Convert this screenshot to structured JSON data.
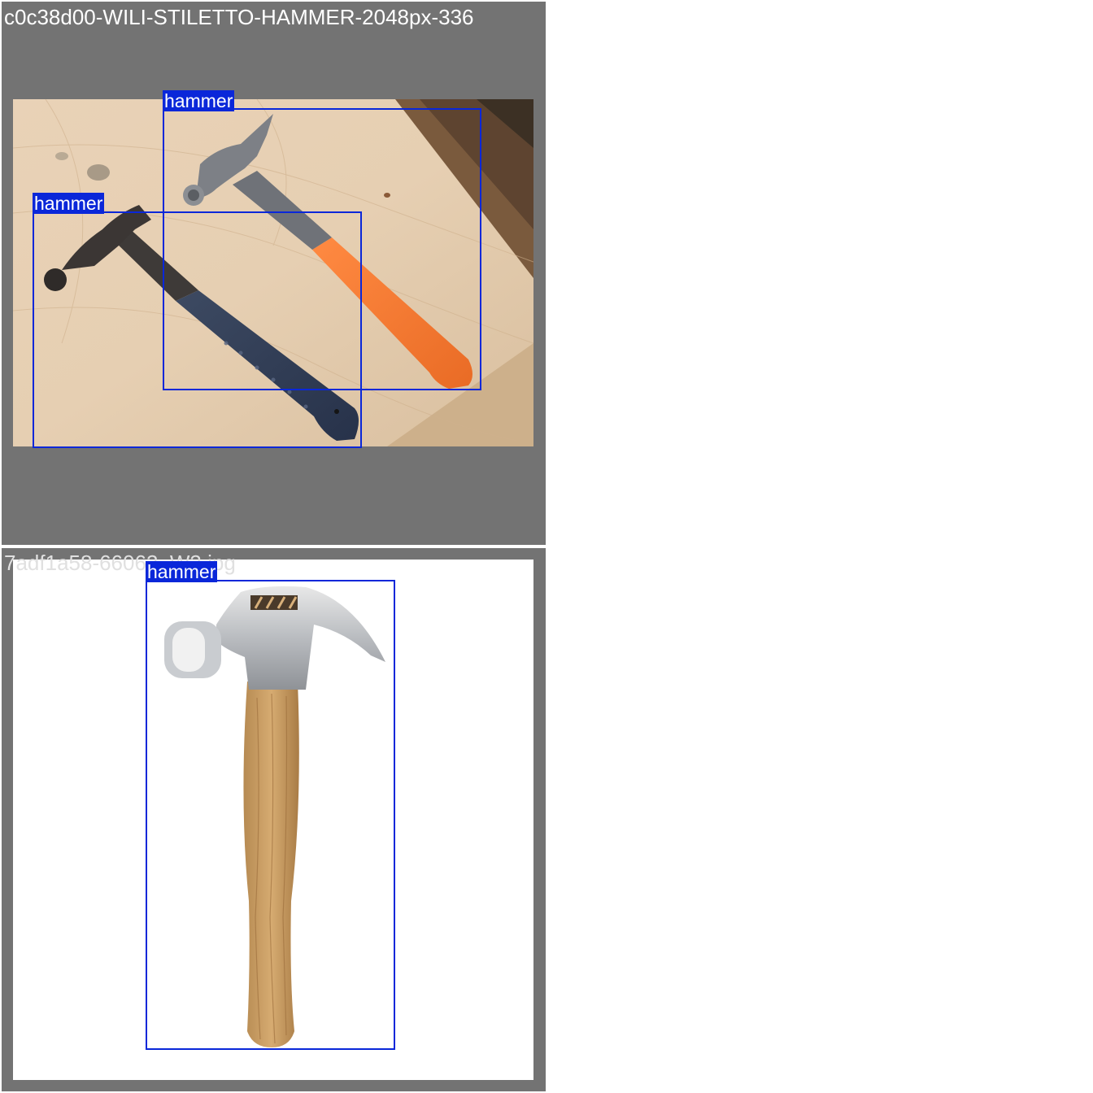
{
  "tiles": [
    {
      "title": "c0c38d00-WILI-STILETTO-HAMMER-2048px-336",
      "detections": [
        {
          "label": "hammer"
        },
        {
          "label": "hammer"
        }
      ]
    },
    {
      "title": "7adf1a58-66063_W3.jpg",
      "detections": [
        {
          "label": "hammer"
        }
      ]
    }
  ],
  "colors": {
    "tile_background": "#737373",
    "box": "#0a27d9",
    "label_text": "#ffffff"
  },
  "icons": {
    "tile-1": [
      "wood-plank-background",
      "claw-hammer-photo",
      "stiletto-titanium-hammer-photo"
    ],
    "tile-2": [
      "wood-handle-claw-hammer-photo"
    ]
  }
}
